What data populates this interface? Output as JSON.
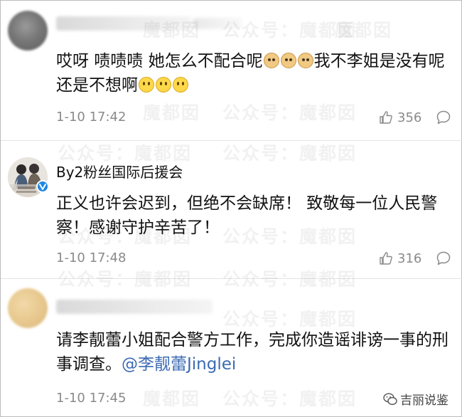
{
  "watermark": {
    "text_full": "公众号：魔都囡",
    "text_short": "魔都囡"
  },
  "comments": [
    {
      "username": "",
      "segments": [
        {
          "text": "哎呀 啧啧啧 她怎么不配合呢"
        },
        {
          "emoji": "doge-emoji"
        },
        {
          "emoji": "doge-emoji"
        },
        {
          "emoji": "doge-emoji"
        },
        {
          "text": "我不李姐是没有呢还是不想啊"
        },
        {
          "emoji": "smile-emoji"
        },
        {
          "emoji": "smile-emoji"
        },
        {
          "emoji": "smile-emoji"
        }
      ],
      "time": "1-10 17:42",
      "likes": "356"
    },
    {
      "username": "By2粉丝国际后援会",
      "verified": true,
      "body": "正义也许会迟到，但绝不会缺席！ 致敬每一位人民警察！感谢守护辛苦了！",
      "time": "1-10 17:48",
      "likes": "316"
    },
    {
      "username": "",
      "body": "请李靓蕾小姐配合警方工作，完成你造谣诽谤一事的刑事调查。",
      "mention": "@李靓蕾Jinglei",
      "time": "1-10 17:45"
    }
  ],
  "brand": {
    "label": "吉丽说鉴",
    "icon": "wechat-icon"
  },
  "colors": {
    "mention": "#3b6bb3",
    "verified_badge": "#1e88e5",
    "meta_gray": "#8a8a8a"
  }
}
